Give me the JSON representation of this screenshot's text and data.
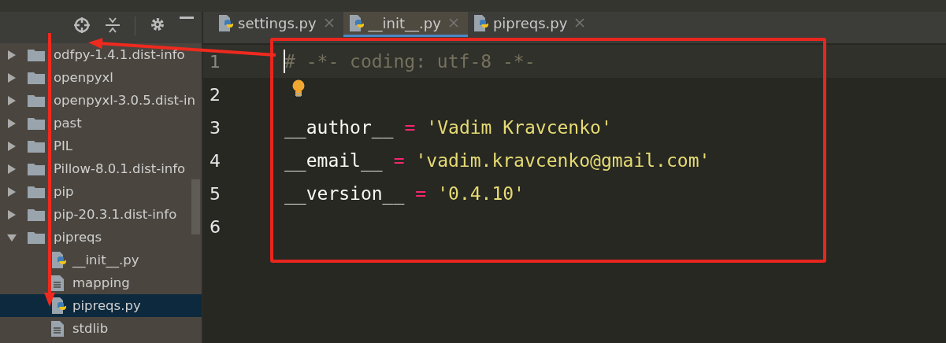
{
  "project_panel": {
    "tree": [
      {
        "kind": "folder",
        "label": "odfpy-1.4.1.dist-info",
        "expanded": false,
        "selected": false
      },
      {
        "kind": "folder",
        "label": "openpyxl",
        "expanded": false,
        "selected": false
      },
      {
        "kind": "folder",
        "label": "openpyxl-3.0.5.dist-in",
        "expanded": false,
        "selected": false
      },
      {
        "kind": "folder",
        "label": "past",
        "expanded": false,
        "selected": false
      },
      {
        "kind": "folder",
        "label": "PIL",
        "expanded": false,
        "selected": false
      },
      {
        "kind": "folder",
        "label": "Pillow-8.0.1.dist-info",
        "expanded": false,
        "selected": false
      },
      {
        "kind": "folder",
        "label": "pip",
        "expanded": false,
        "selected": false
      },
      {
        "kind": "folder",
        "label": "pip-20.3.1.dist-info",
        "expanded": false,
        "selected": false
      },
      {
        "kind": "folder",
        "label": "pipreqs",
        "expanded": true,
        "selected": false,
        "children": [
          {
            "kind": "python-file",
            "label": "__init__.py",
            "selected": false
          },
          {
            "kind": "text-file",
            "label": "mapping",
            "selected": false
          },
          {
            "kind": "python-file",
            "label": "pipreqs.py",
            "selected": true
          },
          {
            "kind": "text-file",
            "label": "stdlib",
            "selected": false
          }
        ]
      }
    ]
  },
  "tabs": [
    {
      "label": "settings.py",
      "selected": false
    },
    {
      "label": "__init__.py",
      "selected": true
    },
    {
      "label": "pipreqs.py",
      "selected": false
    }
  ],
  "editor": {
    "lines": [
      {
        "number": "1",
        "current": true,
        "bulb": false,
        "tokens": [
          {
            "kind": "comment",
            "text": "# -*- coding: utf-8 -*-"
          }
        ]
      },
      {
        "number": "2",
        "current": false,
        "bulb": true
      },
      {
        "number": "3",
        "current": false,
        "bulb": false,
        "tokens": [
          {
            "kind": "name",
            "text": "__author__"
          },
          {
            "kind": "operator",
            "text": "="
          },
          {
            "kind": "string",
            "text": "'Vadim Kravcenko'"
          }
        ]
      },
      {
        "number": "4",
        "current": false,
        "bulb": false,
        "tokens": [
          {
            "kind": "name",
            "text": "__email__"
          },
          {
            "kind": "operator",
            "text": "="
          },
          {
            "kind": "string",
            "text": "'vadim.kravcenko@gmail.com'"
          }
        ]
      },
      {
        "number": "5",
        "current": false,
        "bulb": false,
        "tokens": [
          {
            "kind": "name",
            "text": "__version__"
          },
          {
            "kind": "operator",
            "text": "="
          },
          {
            "kind": "string",
            "text": "'0.4.10'"
          }
        ]
      },
      {
        "number": "6",
        "current": false,
        "bulb": false
      }
    ]
  },
  "annotations": [
    {
      "kind": "box"
    },
    {
      "kind": "arrow"
    },
    {
      "kind": "arrow"
    }
  ]
}
